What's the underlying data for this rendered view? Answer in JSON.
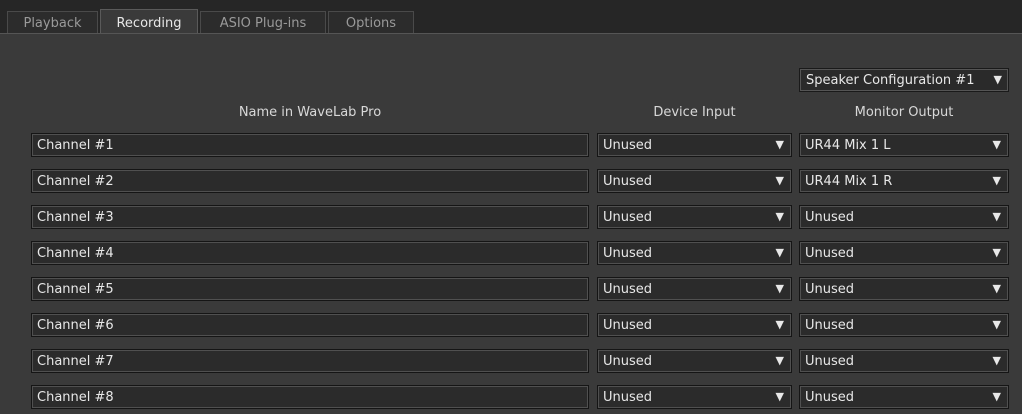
{
  "tabs": [
    {
      "label": "Playback",
      "active": false
    },
    {
      "label": "Recording",
      "active": true
    },
    {
      "label": "ASIO Plug-ins",
      "active": false
    },
    {
      "label": "Options",
      "active": false
    }
  ],
  "speaker_configuration": {
    "selected": "Speaker Configuration #1",
    "arrow": "▼"
  },
  "columns": {
    "name": "Name in WaveLab Pro",
    "device_input": "Device Input",
    "monitor_output": "Monitor Output"
  },
  "arrow_glyph": "▼",
  "channels": [
    {
      "name": "Channel #1",
      "device_input": "Unused",
      "monitor_output": "UR44 Mix 1 L"
    },
    {
      "name": "Channel #2",
      "device_input": "Unused",
      "monitor_output": "UR44 Mix 1 R"
    },
    {
      "name": "Channel #3",
      "device_input": "Unused",
      "monitor_output": "Unused"
    },
    {
      "name": "Channel #4",
      "device_input": "Unused",
      "monitor_output": "Unused"
    },
    {
      "name": "Channel #5",
      "device_input": "Unused",
      "monitor_output": "Unused"
    },
    {
      "name": "Channel #6",
      "device_input": "Unused",
      "monitor_output": "Unused"
    },
    {
      "name": "Channel #7",
      "device_input": "Unused",
      "monitor_output": "Unused"
    },
    {
      "name": "Channel #8",
      "device_input": "Unused",
      "monitor_output": "Unused"
    }
  ]
}
